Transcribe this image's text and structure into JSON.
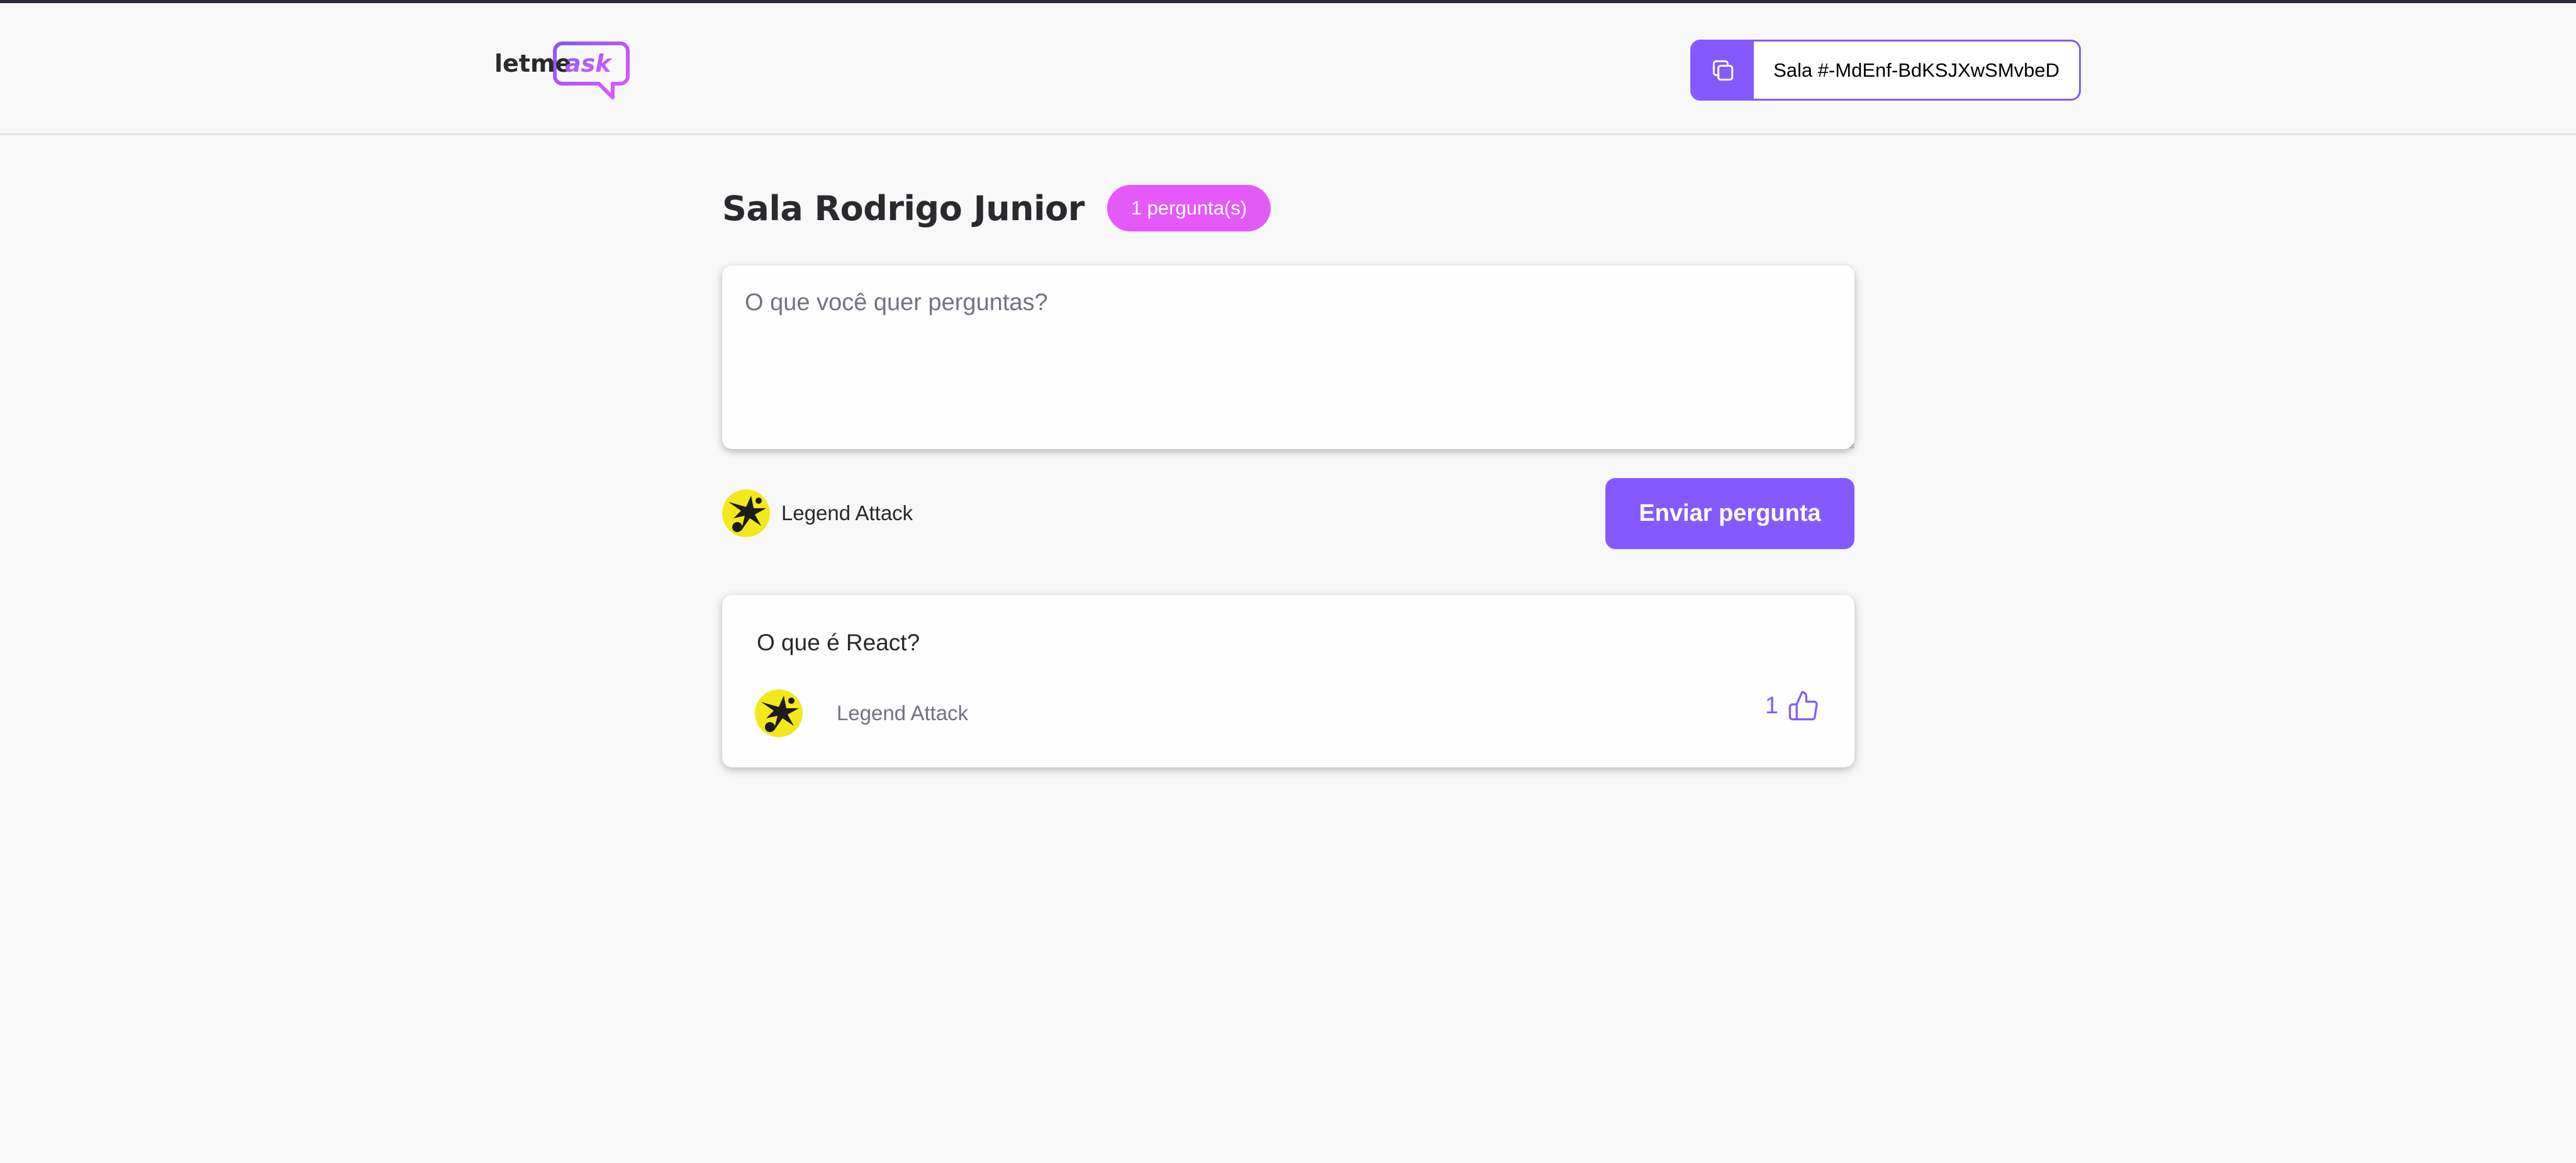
{
  "header": {
    "logo_text_main": "letme",
    "logo_text_accent": "ask",
    "room_code_label": "Sala #-MdEnf-BdKSJXwSMvbeD"
  },
  "room": {
    "title": "Sala Rodrigo Junior",
    "question_count_badge": "1 pergunta(s)"
  },
  "form": {
    "placeholder": "O que você quer perguntas?",
    "user_name": "Legend Attack",
    "submit_label": "Enviar pergunta"
  },
  "questions": [
    {
      "content": "O que é React?",
      "author": "Legend Attack",
      "like_count": "1"
    }
  ],
  "colors": {
    "brand_purple": "#835afd",
    "badge_pink": "#e559f9",
    "background": "#f8f8f8",
    "text_dark": "#29292e",
    "text_muted": "#737380"
  },
  "icons": [
    "copy-icon",
    "like-icon"
  ]
}
